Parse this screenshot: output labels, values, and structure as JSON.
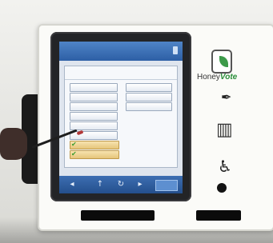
{
  "kiosk": {
    "brand": {
      "name_part1": "Honey",
      "name_part2": "Vote",
      "logo_icon": "leaf-logo-icon"
    },
    "side_icons": [
      "pen-icon",
      "ballot-box-icon",
      "accessibility-icon"
    ],
    "colors": {
      "screen_header": "#2d5fa5",
      "selected_option": "#e6c57a",
      "brand_accent": "#2a8e3a"
    }
  },
  "screen": {
    "title": "",
    "panel_title": "",
    "options": [
      {
        "label": "",
        "selected": false
      },
      {
        "label": "",
        "selected": false
      },
      {
        "label": "",
        "selected": false
      },
      {
        "label": "",
        "selected": false
      },
      {
        "label": "",
        "selected": false
      },
      {
        "label": "",
        "selected": false
      },
      {
        "label": "",
        "selected": true
      },
      {
        "label": "",
        "selected": true
      },
      {
        "label": "",
        "selected": false
      },
      {
        "label": "",
        "selected": false
      },
      {
        "label": "",
        "selected": false
      }
    ],
    "footer": {
      "back_icon": "back-icon",
      "up_icon": "up-arrow-icon",
      "refresh_icon": "refresh-icon",
      "next_icon": "next-icon",
      "done_label": ""
    }
  },
  "captions": {
    "left": "",
    "right": ""
  }
}
